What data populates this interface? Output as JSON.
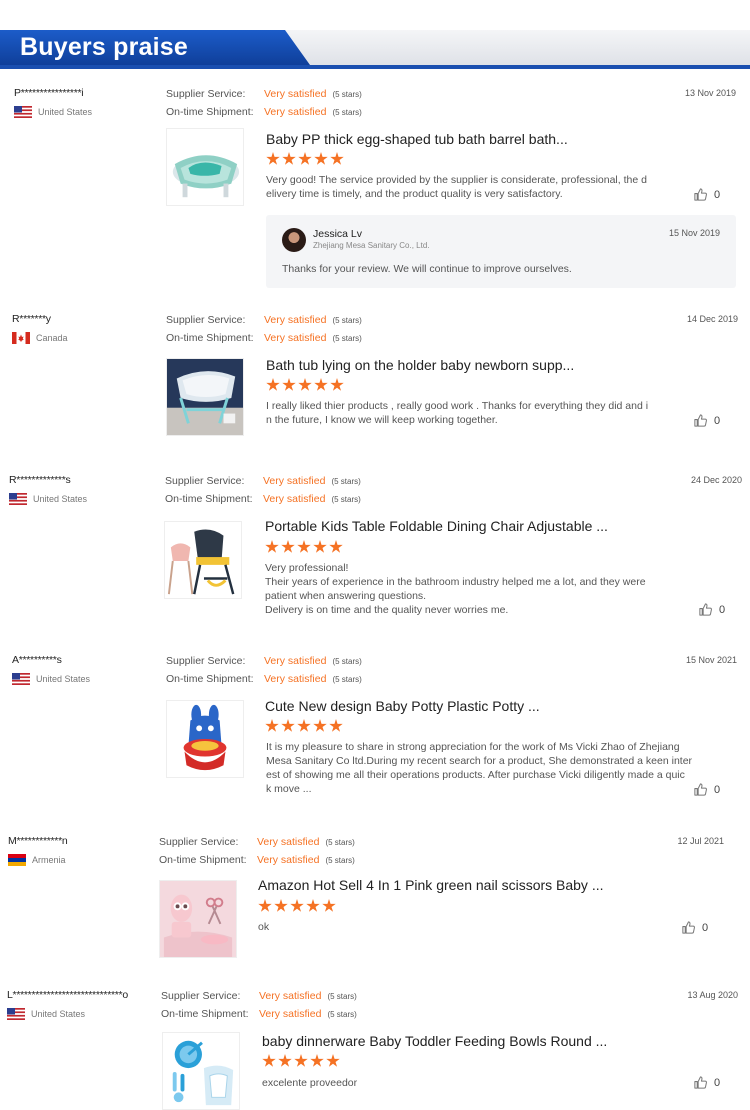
{
  "header": {
    "title": "Buyers praise",
    "accent": "#1a4fb0"
  },
  "colors": {
    "satisfied": "#f57224",
    "stars": "#f57224"
  },
  "reviews": [
    {
      "name": "P****************i",
      "country": "United States",
      "flag": "us-flag",
      "date": "13 Nov 2019",
      "supplier_label": "Supplier Service:",
      "supplier_value": "Very satisfied",
      "supplier_stars": "(5 stars)",
      "shipment_label": "On-time Shipment:",
      "shipment_value": "Very satisfied",
      "shipment_stars": "(5 stars)",
      "product": "Baby PP thick egg-shaped tub bath barrel bath...",
      "rating": 5,
      "comment": "Very good! The service provided by the supplier is considerate, professional, the d\nelivery time is timely, and the product quality is very satisfactory.",
      "likes": "0",
      "reply": {
        "name": "Jessica Lv",
        "company": "Zhejiang Mesa Sanitary Co., Ltd.",
        "date": "15 Nov 2019",
        "text": "Thanks for your review. We will continue to improve ourselves."
      }
    },
    {
      "name": "R*******y",
      "country": "Canada",
      "flag": "canada-flag",
      "date": "14 Dec 2019",
      "supplier_label": "Supplier Service:",
      "supplier_value": "Very satisfied",
      "supplier_stars": "(5 stars)",
      "shipment_label": "On-time Shipment:",
      "shipment_value": "Very satisfied",
      "shipment_stars": "(5 stars)",
      "product": "Bath tub lying on the holder baby newborn supp...",
      "rating": 5,
      "comment": "I really liked thier products , really good work . Thanks for everything they did and i\nn the future, I know we will keep working together.",
      "likes": "0"
    },
    {
      "name": "R*************s",
      "country": "United States",
      "flag": "us-flag",
      "date": "24 Dec 2020",
      "supplier_label": "Supplier Service:",
      "supplier_value": "Very satisfied",
      "supplier_stars": "(5 stars)",
      "shipment_label": "On-time Shipment:",
      "shipment_value": "Very satisfied",
      "shipment_stars": "(5 stars)",
      "product": "Portable Kids Table Foldable Dining Chair Adjustable ...",
      "rating": 5,
      "comment": "Very professional!\nTheir years of experience in the bathroom industry helped me a lot, and they were\npatient when answering questions.\nDelivery is on time and the quality never worries me.",
      "likes": "0"
    },
    {
      "name": "A**********s",
      "country": "United States",
      "flag": "us-flag",
      "date": "15 Nov 2021",
      "supplier_label": "Supplier Service:",
      "supplier_value": "Very satisfied",
      "supplier_stars": "(5 stars)",
      "shipment_label": "On-time Shipment:",
      "shipment_value": "Very satisfied",
      "shipment_stars": "(5 stars)",
      "product": "Cute New design Baby Potty Plastic Potty ...",
      "rating": 5,
      "comment": "It is my pleasure to share in strong appreciation for the work of Ms Vicki Zhao of Zhejiang\nMesa Sanitary Co ltd.During my recent search for a product, She demonstrated a keen inter\nest of showing me all their operations products. After purchase Vicki diligently made a quic\nk move ...",
      "likes": "0"
    },
    {
      "name": "M************n",
      "country": "Armenia",
      "flag": "armenia-flag",
      "date": "12 Jul 2021",
      "supplier_label": "Supplier Service:",
      "supplier_value": "Very satisfied",
      "supplier_stars": "(5 stars)",
      "shipment_label": "On-time Shipment:",
      "shipment_value": "Very satisfied",
      "shipment_stars": "(5 stars)",
      "product": "Amazon Hot Sell 4 In 1 Pink green nail scissors Baby ...",
      "rating": 5,
      "comment": "ok",
      "likes": "0"
    },
    {
      "name": "L*****************************o",
      "country": "United States",
      "flag": "us-flag",
      "date": "13 Aug 2020",
      "supplier_label": "Supplier Service:",
      "supplier_value": "Very satisfied",
      "supplier_stars": "(5 stars)",
      "shipment_label": "On-time Shipment:",
      "shipment_value": "Very satisfied",
      "shipment_stars": "(5 stars)",
      "product": "baby dinnerware Baby Toddler Feeding Bowls Round ...",
      "rating": 5,
      "comment": "excelente proveedor",
      "likes": "0"
    }
  ]
}
